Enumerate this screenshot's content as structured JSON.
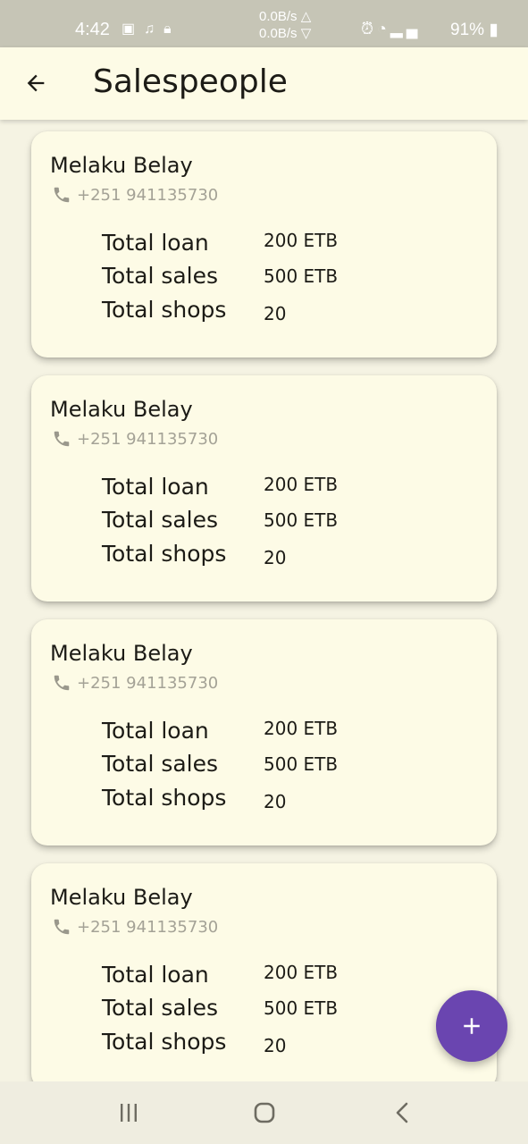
{
  "status_bar": {
    "time": "4:42",
    "net_up": "0.0B/s △",
    "net_down": "0.0B/s ▽",
    "battery": "91%",
    "icons": [
      "image-icon",
      "music-note-icon",
      "lock-icon",
      "alarm-icon",
      "wifi-icon",
      "signal-icon",
      "signal-icon",
      "battery-charging-icon"
    ]
  },
  "app_bar": {
    "title": "Salespeople",
    "back_icon": "arrow-left-icon"
  },
  "salespeople": [
    {
      "name": "Melaku Belay",
      "phone": "+251 941135730",
      "loan_label": "Total loan",
      "loan": "200 ETB",
      "sales_label": "Total sales",
      "sales": "500 ETB",
      "shops_label": "Total shops",
      "shops": "20"
    },
    {
      "name": "Melaku Belay",
      "phone": "+251 941135730",
      "loan_label": "Total loan",
      "loan": "200 ETB",
      "sales_label": "Total sales",
      "sales": "500 ETB",
      "shops_label": "Total shops",
      "shops": "20"
    },
    {
      "name": "Melaku Belay",
      "phone": "+251 941135730",
      "loan_label": "Total loan",
      "loan": "200 ETB",
      "sales_label": "Total sales",
      "sales": "500 ETB",
      "shops_label": "Total shops",
      "shops": "20"
    },
    {
      "name": "Melaku Belay",
      "phone": "+251 941135730",
      "loan_label": "Total loan",
      "loan": "200 ETB",
      "sales_label": "Total sales",
      "sales": "500 ETB",
      "shops_label": "Total shops",
      "shops": "20"
    }
  ],
  "fab": {
    "icon": "plus-icon",
    "color": "#6a45b0"
  },
  "colors": {
    "background": "#f5f3e3",
    "card": "#fdfbe6",
    "status_bar": "#c6c5b6",
    "accent": "#6a45b0"
  }
}
